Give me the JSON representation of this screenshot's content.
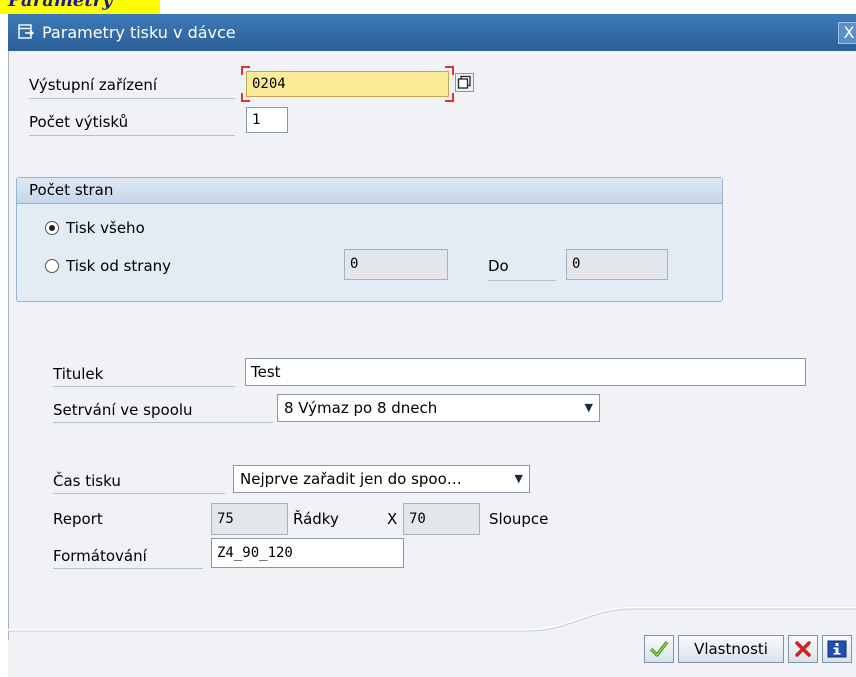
{
  "top_tag": "Parametry",
  "window": {
    "title": "Parametry tisku v dávce",
    "close": "X"
  },
  "output": {
    "device_label": "Výstupní zařízení",
    "device_value": "0204",
    "copies_label": "Počet výtisků",
    "copies_value": "1"
  },
  "pages": {
    "group_title": "Počet stran",
    "print_all_label": "Tisk všeho",
    "print_from_label": "Tisk od strany",
    "from_value": "0",
    "to_label": "Do",
    "to_value": "0",
    "selected": "print_all"
  },
  "spool": {
    "title_label": "Titulek",
    "title_value": "Test",
    "retention_label": "Setrvání ve spoolu",
    "retention_value": "8 Výmaz po 8 dnech",
    "print_time_label": "Čas tisku",
    "print_time_value": "Nejprve zařadit jen do spoo…",
    "report_label": "Report",
    "rows_value": "75",
    "rows_label": "Řádky",
    "times": "X",
    "cols_value": "70",
    "cols_label": "Sloupce",
    "format_label": "Formátování",
    "format_value": "Z4_90_120"
  },
  "footer": {
    "confirm_icon": "check-icon",
    "properties_label": "Vlastnosti",
    "cancel_icon": "cancel-x-icon",
    "info_icon": "info-icon"
  },
  "colors": {
    "titlebar": "#2c5f96",
    "highlight_field": "#fcec9a",
    "group_bg": "#e3ecf5"
  }
}
